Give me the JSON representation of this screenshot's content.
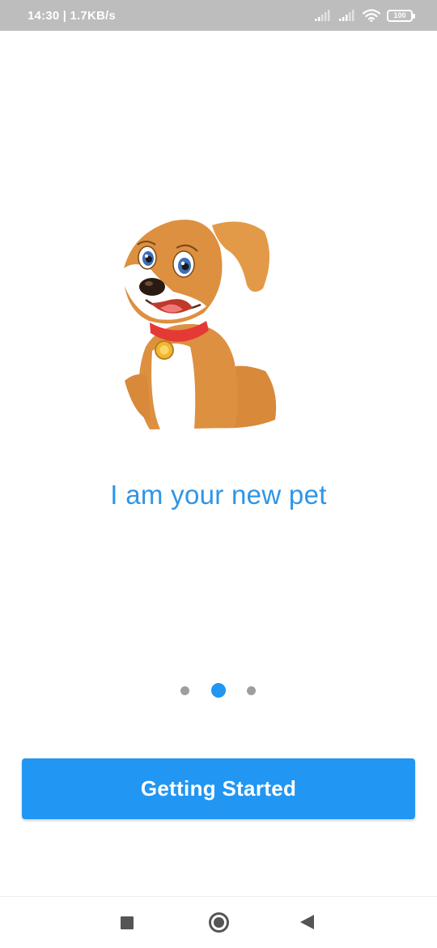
{
  "status_bar": {
    "time_speed": "14:30 | 1.7KB/s",
    "battery": "100",
    "icons": [
      "signal-icon",
      "signal-icon",
      "wifi-icon",
      "battery-icon"
    ]
  },
  "onboarding": {
    "illustration": "puppy-illustration",
    "headline": "I am your new pet",
    "pager": {
      "total": 3,
      "active_index": 1
    },
    "cta_label": "Getting Started"
  },
  "nav_bar": {
    "icons": [
      "recent-apps-icon",
      "home-icon",
      "back-icon"
    ]
  },
  "colors": {
    "accent": "#2196f3",
    "headline": "#2f95e6",
    "status_bar_bg": "#bdbdbd",
    "dot_inactive": "#9e9e9e"
  }
}
